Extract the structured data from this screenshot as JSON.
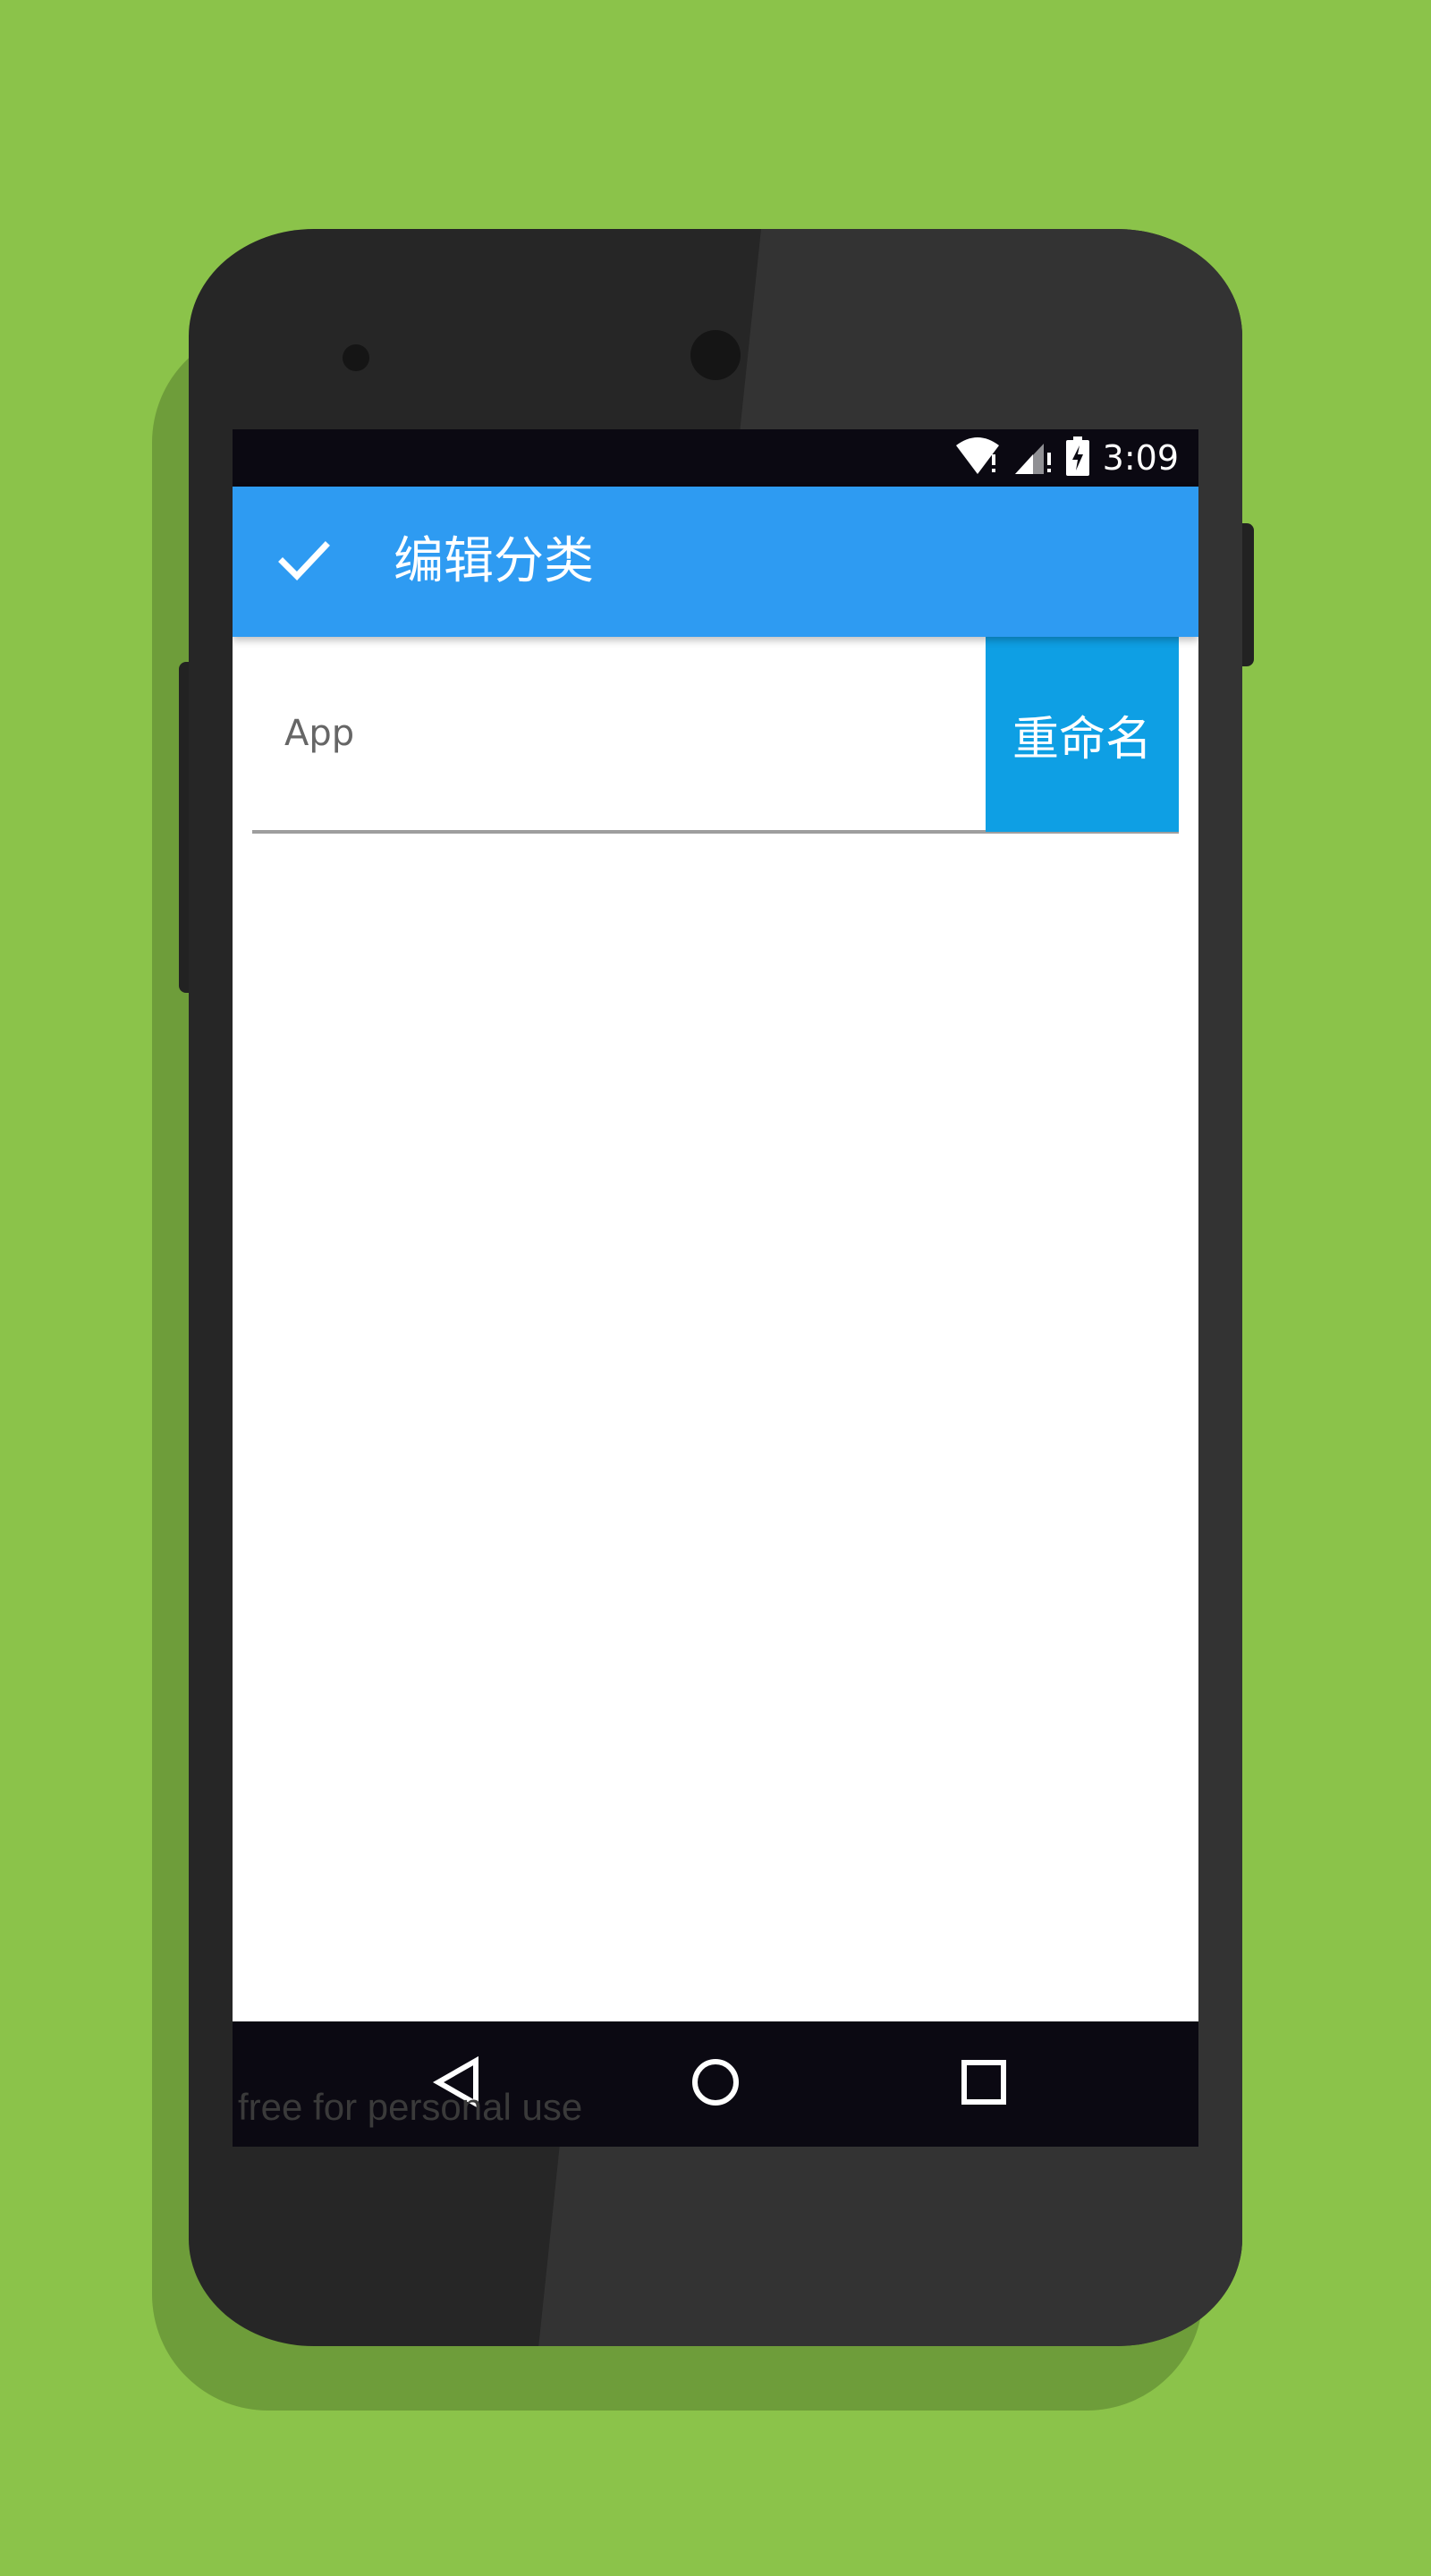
{
  "status_bar": {
    "time": "3:09",
    "icons": [
      "wifi-icon",
      "signal-icon",
      "battery-charging-icon"
    ]
  },
  "app_bar": {
    "title": "编辑分类",
    "confirm_icon": "check-icon"
  },
  "form": {
    "name_value": "App",
    "rename_label": "重命名"
  },
  "nav_bar": {
    "icons": [
      "back-icon",
      "home-icon",
      "recents-icon"
    ]
  },
  "watermark": "free for personal use",
  "colors": {
    "background": "#8bc34a",
    "app_bar": "#2e9bf2",
    "rename_button": "#0e9fe4",
    "system_bars": "#0b0912"
  }
}
